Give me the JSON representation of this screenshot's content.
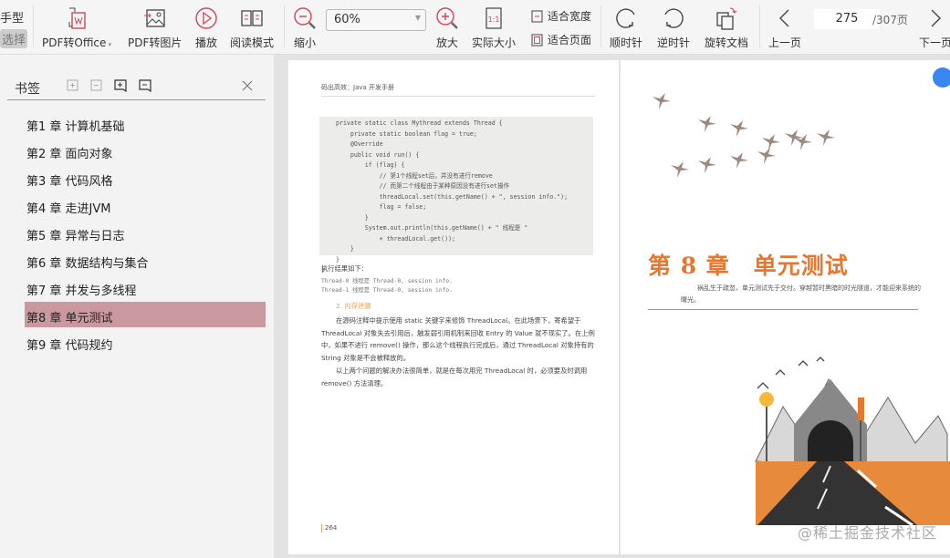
{
  "toolbar": {
    "left_partial_1": "手型",
    "left_partial_2": "选择",
    "pdf_to_office": "PDF转Office",
    "pdf_to_image": "PDF转图片",
    "play": "播放",
    "read_mode": "阅读模式",
    "zoom_out": "缩小",
    "zoom_value": "60%",
    "zoom_in": "放大",
    "actual_size": "实际大小",
    "actual_size_glyph": "1:1",
    "fit_width": "适合宽度",
    "fit_page": "适合页面",
    "clockwise": "顺时针",
    "counterclockwise": "逆时针",
    "rotate_doc": "旋转文档",
    "prev_page": "上一页",
    "current_page": "275",
    "total_pages": "/307页",
    "next_page": "下一页"
  },
  "sidebar": {
    "title": "书签",
    "bookmarks": [
      {
        "label": "第1 章 计算机基础"
      },
      {
        "label": "第2 章 面向对象"
      },
      {
        "label": "第3 章 代码风格"
      },
      {
        "label": "第4 章 走进JVM"
      },
      {
        "label": "第5 章 异常与日志"
      },
      {
        "label": "第6 章 数据结构与集合"
      },
      {
        "label": "第7 章 并发与多线程"
      },
      {
        "label": "第8 章 单元测试",
        "selected": true
      },
      {
        "label": "第9 章 代码规约"
      }
    ]
  },
  "left_page": {
    "header": "码出高效：Java 开发手册",
    "code": [
      "private static class Mythread extends Thread {",
      "    private static boolean flag = true;",
      "",
      "    @Override",
      "    public void run() {",
      "        if (flag) {",
      "            // 第1个线程set后，并没有进行remove",
      "            // 而第二个线程由于某种原因没有进行set操作",
      "            threadLocal.set(this.getName() + \", session info.\");",
      "            flag = false;",
      "        }",
      "        System.out.println(this.getName() + \" 线程是 \"",
      "            + threadLocal.get());",
      "    }",
      "}",
      "}"
    ],
    "result_label": "执行结果如下：",
    "output": [
      "Thread-0 线程是 Thread-0, session info.",
      "Thread-1 线程是 Thread-0, session info."
    ],
    "section": "2. 内存泄漏",
    "para1": "在源码注释中提示使用 static 关键字来修饰 ThreadLocal。在此场景下，寄希望于 ThreadLocal 对象失去引用后，触发弱引用机制来回收 Entry 的 Value 就不现实了。在上例中，如果不进行 remove() 操作，那么这个线程执行完成后，通过 ThreadLocal 对象持有的 String 对象是不会被释放的。",
    "para2": "以上两个问题的解决办法很简单，就是在每次用完 ThreadLocal 时，必须要及时调用 remove() 方法清理。",
    "page_number": "264"
  },
  "right_page": {
    "chapter_title": "第 8 章　单元测试",
    "epigraph": "祸乱生于疏忽，单元测试先于交付。穿越暂时黑暗的时光隧道，才能迎来系统的曙光。"
  },
  "watermark": "@稀土掘金技术社区",
  "colors": {
    "accent_red": "#d0455a",
    "selected_bookmark": "#c9999f",
    "chapter_orange": "#e8762c"
  }
}
